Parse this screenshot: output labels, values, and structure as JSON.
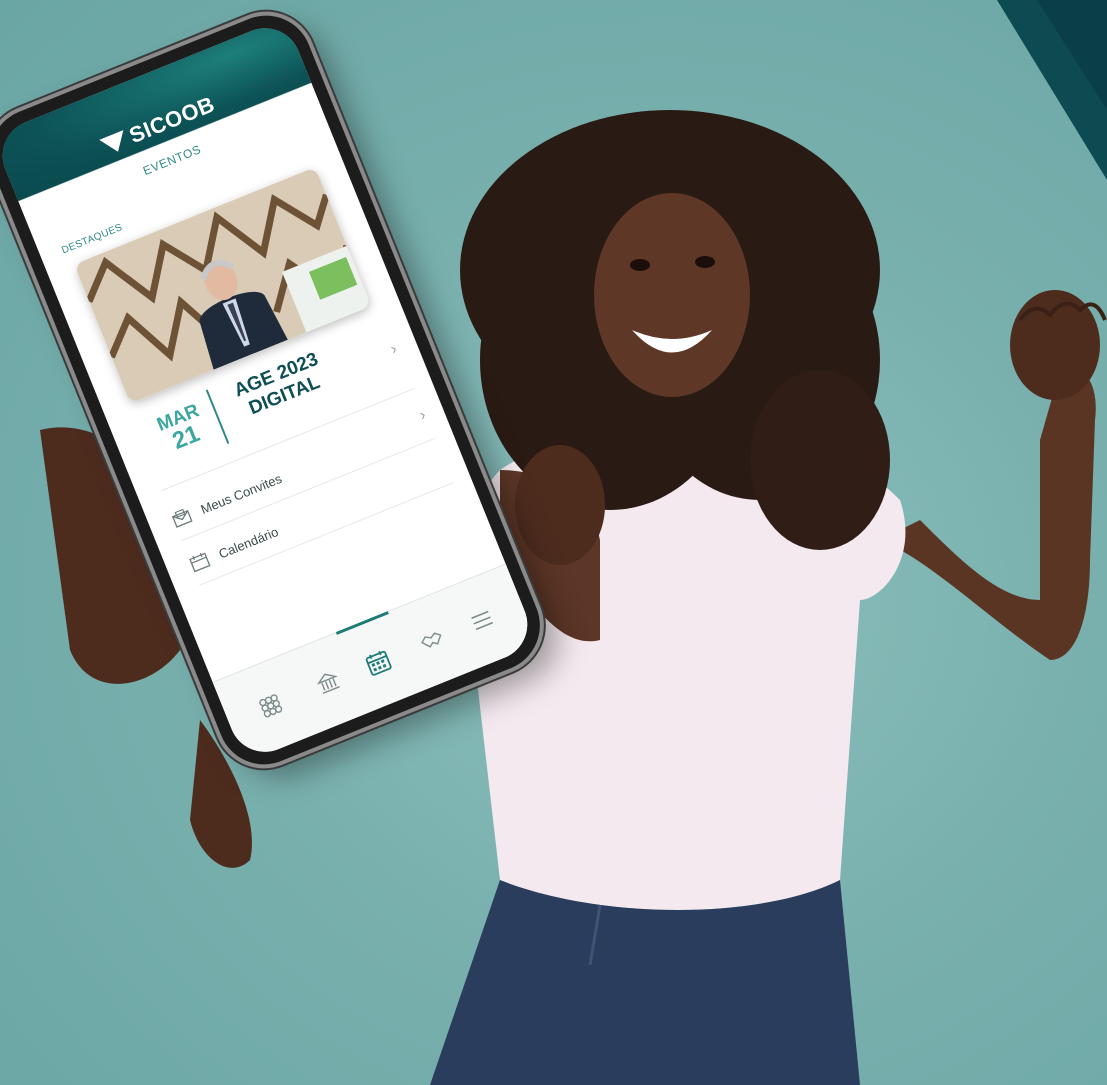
{
  "colors": {
    "background": "#76aeac",
    "brand_dark": "#0c5256",
    "brand_accent": "#3aa7a0",
    "shirt": "#f3e9ee",
    "jeans": "#2b3d5c"
  },
  "app": {
    "logo_text": "SICOOB",
    "logo_icon": "sicoob-logo-icon",
    "screen_title": "EVENTOS"
  },
  "featured": {
    "section_label": "DESTAQUES"
  },
  "event": {
    "month": "MAR",
    "day": "21",
    "title_line1": "AGE 2023",
    "title_line2": "DIGITAL"
  },
  "menu": [
    {
      "label": "Meus Convites",
      "icon": "invitation-icon"
    },
    {
      "label": "Calendário",
      "icon": "calendar-icon"
    }
  ],
  "bottom_nav": [
    {
      "icon": "grid-icon",
      "active": false
    },
    {
      "icon": "bank-icon",
      "active": false
    },
    {
      "icon": "calendar-icon",
      "active": true
    },
    {
      "icon": "handshake-icon",
      "active": false
    },
    {
      "icon": "menu-icon",
      "active": false
    }
  ]
}
